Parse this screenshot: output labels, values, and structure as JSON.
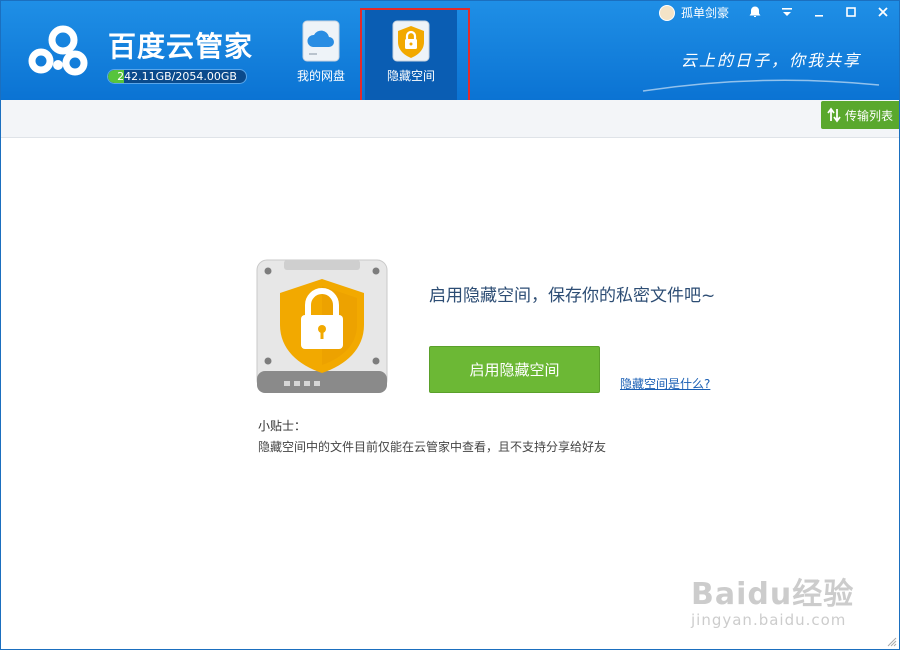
{
  "app": {
    "title": "百度云管家"
  },
  "quota": {
    "text": "242.11GB/2054.00GB",
    "used_fraction": 0.118
  },
  "nav": [
    {
      "label": "我的网盘",
      "icon": "cloud-disk-icon"
    },
    {
      "label": "隐藏空间",
      "icon": "lock-shield-icon",
      "active": true
    }
  ],
  "user": {
    "name": "孤单剑豪"
  },
  "slogan": "云上的日子，你我共享",
  "toolbar": {
    "transfer_label": "传输列表"
  },
  "main": {
    "headline": "启用隐藏空间，保存你的私密文件吧~",
    "enable_button": "启用隐藏空间",
    "what_link": "隐藏空间是什么?",
    "tips_title": "小贴士：",
    "tips_text": "隐藏空间中的文件目前仅能在云管家中查看，且不支持分享给好友"
  },
  "watermark": {
    "brand": "Baidu经验",
    "url": "jingyan.baidu.com"
  },
  "colors": {
    "header": "#0b73d3",
    "accent_green": "#6cb835",
    "highlight_red": "#e32b2b",
    "shield_orange": "#f2a900"
  }
}
